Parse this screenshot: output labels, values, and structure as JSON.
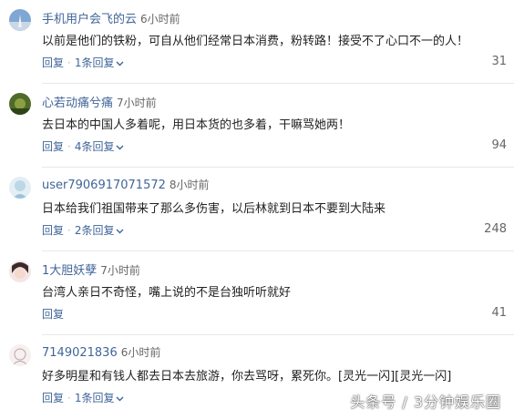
{
  "comments": [
    {
      "username": "手机用户会飞的云",
      "time": "6小时前",
      "text": "以前是他们的铁粉，可自从他们经常日本消费，粉转路！接受不了心口不一的人！",
      "reply_label": "回复",
      "reply_count_label": "1条回复",
      "likes": "31",
      "avatar_icon": "avatar-landscape-icon"
    },
    {
      "username": "心若动痛兮痛",
      "time": "7小时前",
      "text": "去日本的中国人多着呢，用日本货的也多着，干嘛骂她两！",
      "reply_label": "回复",
      "reply_count_label": "4条回复",
      "likes": "94",
      "avatar_icon": "avatar-nature-icon"
    },
    {
      "username": "user7906917071572",
      "time": "8小时前",
      "text": "日本给我们祖国带来了那么多伤害，以后林就到日本不要到大陆来",
      "reply_label": "回复",
      "reply_count_label": "2条回复",
      "likes": "248",
      "avatar_icon": "avatar-default-icon"
    },
    {
      "username": "1大胆妖孽",
      "time": "7小时前",
      "text": "台湾人亲日不奇怪，嘴上说的不是台独听听就好",
      "reply_label": "回复",
      "reply_count_label": "",
      "likes": "41",
      "avatar_icon": "avatar-anime-icon"
    },
    {
      "username": "7149021836",
      "time": "6小时前",
      "text": "好多明星和有钱人都去日本去旅游，你去骂呀，累死你。[灵光一闪][灵光一闪]",
      "reply_label": "回复",
      "reply_count_label": "1条回复",
      "likes": "",
      "avatar_icon": "avatar-sketch-icon"
    }
  ],
  "watermark": "头条号 / 3分钟娱乐圈",
  "colors": {
    "username": "#406599",
    "text": "#222222",
    "meta": "#666666",
    "divider": "#e8e8e8"
  }
}
